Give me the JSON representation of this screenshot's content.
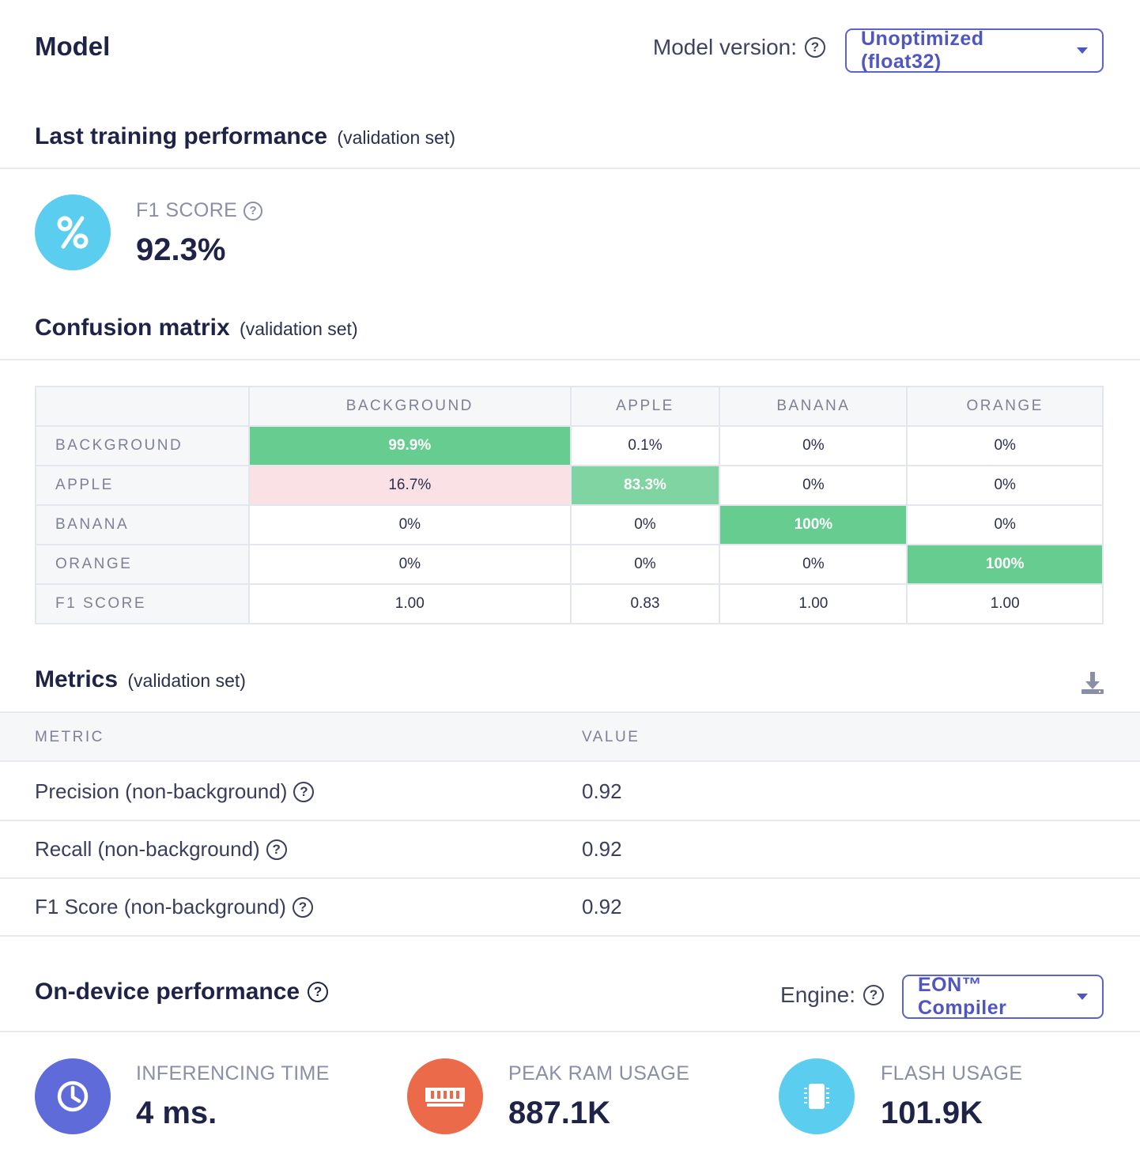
{
  "header": {
    "title": "Model",
    "model_version_label": "Model version:",
    "model_version_value": "Unoptimized (float32)"
  },
  "training": {
    "title": "Last training performance",
    "subtitle": "(validation set)",
    "f1_label": "F1 SCORE",
    "f1_value": "92.3%",
    "icon": "percent-icon",
    "icon_color": "#5bcdee"
  },
  "confusion": {
    "title": "Confusion matrix",
    "subtitle": "(validation set)",
    "columns": [
      "BACKGROUND",
      "APPLE",
      "BANANA",
      "ORANGE"
    ],
    "rows": [
      {
        "label": "BACKGROUND",
        "cells": [
          "99.9%",
          "0.1%",
          "0%",
          "0%"
        ]
      },
      {
        "label": "APPLE",
        "cells": [
          "16.7%",
          "83.3%",
          "0%",
          "0%"
        ]
      },
      {
        "label": "BANANA",
        "cells": [
          "0%",
          "0%",
          "100%",
          "0%"
        ]
      },
      {
        "label": "ORANGE",
        "cells": [
          "0%",
          "0%",
          "0%",
          "100%"
        ]
      }
    ],
    "f1_row": {
      "label": "F1 SCORE",
      "cells": [
        "1.00",
        "0.83",
        "1.00",
        "1.00"
      ]
    },
    "colors": {
      "correct": "#66cc8f",
      "partial": "#7fd4a1",
      "error": "#f9e1e5"
    }
  },
  "metrics": {
    "title": "Metrics",
    "subtitle": "(validation set)",
    "col_metric": "METRIC",
    "col_value": "VALUE",
    "rows": [
      {
        "name": "Precision (non-background)",
        "value": "0.92"
      },
      {
        "name": "Recall (non-background)",
        "value": "0.92"
      },
      {
        "name": "F1 Score (non-background)",
        "value": "0.92"
      }
    ]
  },
  "device": {
    "title": "On-device performance",
    "engine_label": "Engine:",
    "engine_value": "EON™ Compiler",
    "stats": [
      {
        "label": "INFERENCING TIME",
        "value": "4 ms.",
        "icon": "clock-icon",
        "color": "#5f6bd9"
      },
      {
        "label": "PEAK RAM USAGE",
        "value": "887.1K",
        "icon": "ram-icon",
        "color": "#ea6a4a"
      },
      {
        "label": "FLASH USAGE",
        "value": "101.9K",
        "icon": "chip-icon",
        "color": "#5bcdee"
      }
    ]
  }
}
